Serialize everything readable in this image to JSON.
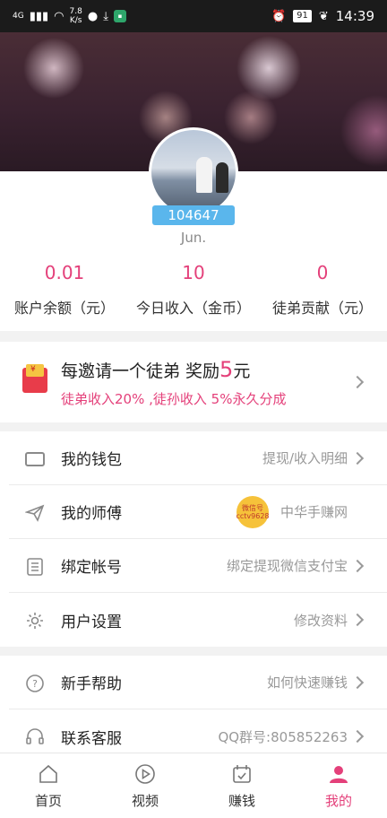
{
  "status_bar": {
    "signal": "4G",
    "speed": "7.8",
    "speed_unit": "K/s",
    "battery": "91",
    "time": "14:39"
  },
  "profile": {
    "user_id": "104647",
    "username": "Jun."
  },
  "stats": [
    {
      "value": "0.01",
      "label": "账户余额（元）"
    },
    {
      "value": "10",
      "label": "今日收入（金币）"
    },
    {
      "value": "0",
      "label": "徒弟贡献（元）"
    }
  ],
  "invite": {
    "title_prefix": "每邀请一个徒弟 奖励",
    "amount": "5",
    "unit": "元",
    "subtitle": "徒弟收入20% ,徒孙收入 5%永久分成"
  },
  "menu_group1": [
    {
      "label": "我的钱包",
      "value": "提现/收入明细",
      "icon": "wallet-icon"
    },
    {
      "label": "我的师傅",
      "value": "中华手赚网",
      "icon": "paper-plane-icon"
    },
    {
      "label": "绑定帐号",
      "value": "绑定提现微信支付宝",
      "icon": "list-icon"
    },
    {
      "label": "用户设置",
      "value": "修改资料",
      "icon": "gear-icon"
    }
  ],
  "master_logo_text": "微信号 cctv9628",
  "menu_group2": [
    {
      "label": "新手帮助",
      "value": "如何快速赚钱",
      "icon": "help-icon"
    },
    {
      "label": "联系客服",
      "value": "QQ群号:805852263",
      "icon": "headset-icon"
    }
  ],
  "tabs": [
    {
      "label": "首页",
      "icon": "home-icon"
    },
    {
      "label": "视频",
      "icon": "play-icon"
    },
    {
      "label": "赚钱",
      "icon": "calendar-check-icon"
    },
    {
      "label": "我的",
      "icon": "user-icon",
      "active": true
    }
  ],
  "colors": {
    "accent": "#e4407a",
    "ribbon": "#5ab6ec"
  }
}
